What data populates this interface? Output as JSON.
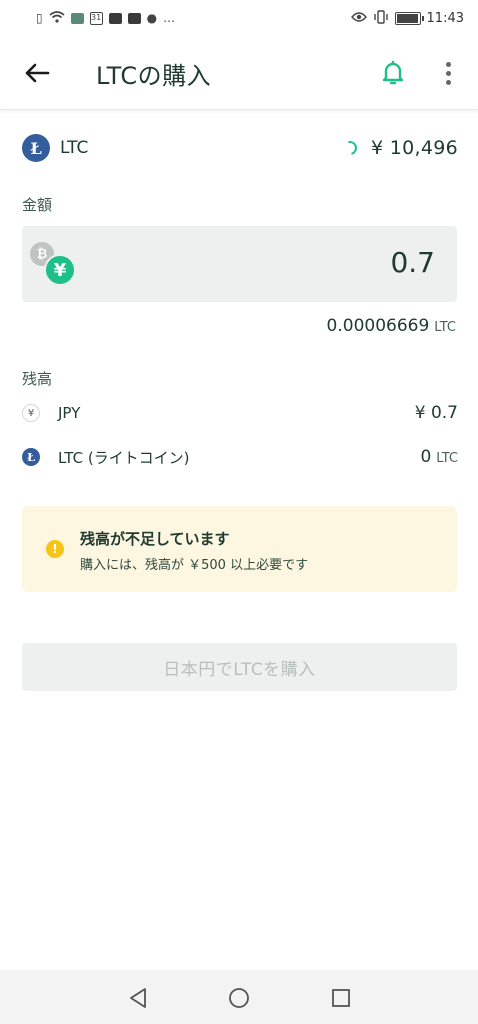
{
  "status_bar": {
    "time": "11:43",
    "left_icons": [
      "sim-alert-icon",
      "wifi-icon",
      "app-icon",
      "calendar-icon",
      "youtube-icon",
      "youtube-icon",
      "chat-icon",
      "more-dots-icon"
    ],
    "calendar_day": "31",
    "right_icons": [
      "eye-icon",
      "vibrate-icon",
      "battery-icon"
    ],
    "battery_level": 0.9
  },
  "app_bar": {
    "title": "LTCの購入"
  },
  "coin": {
    "symbol": "LTC",
    "price": "¥ 10,496"
  },
  "amount": {
    "label": "金額",
    "value": "0.7",
    "converted_value": "0.00006669",
    "converted_unit": "LTC"
  },
  "balance": {
    "label": "残高",
    "rows": [
      {
        "name": "JPY",
        "value": "¥ 0.7",
        "unit": ""
      },
      {
        "name": "LTC (ライトコイン)",
        "value": "0",
        "unit": "LTC"
      }
    ]
  },
  "alert": {
    "title": "残高が不足しています",
    "message": "購入には、残高が ￥500 以上必要です"
  },
  "buy_button": {
    "label": "日本円でLTCを購入"
  },
  "colors": {
    "accent": "#1fbf8a",
    "ltc": "#345d9d",
    "alert_bg": "#fdf6e0",
    "alert_icon": "#f5c518"
  }
}
